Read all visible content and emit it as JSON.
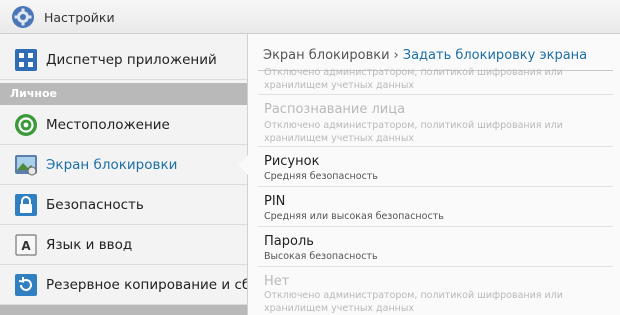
{
  "header": {
    "title": "Настройки",
    "icon": "settings-gear-icon"
  },
  "sidebar": {
    "items": [
      {
        "label": "Диспетчер приложений",
        "icon": "app-grid-icon"
      },
      {
        "section": "Личное"
      },
      {
        "label": "Местоположение",
        "icon": "location-icon"
      },
      {
        "label": "Экран блокировки",
        "icon": "lock-screen-icon",
        "active": true
      },
      {
        "label": "Безопасность",
        "icon": "padlock-icon"
      },
      {
        "label": "Язык и ввод",
        "icon": "keyboard-a-icon"
      },
      {
        "label": "Резервное копирование и сб...",
        "icon": "backup-icon"
      }
    ]
  },
  "breadcrumb": {
    "parent": "Экран блокировки",
    "separator": "›",
    "current": "Задать блокировку экрана"
  },
  "options": [
    {
      "title": "",
      "subtitle": "Отключено администратором, политикой шифрования или хранилищем учетных данных",
      "enabled": false
    },
    {
      "title": "Распознавание лица",
      "subtitle": "Отключено администратором, политикой шифрования или хранилищем учетных данных",
      "enabled": false
    },
    {
      "title": "Рисунок",
      "subtitle": "Средняя безопасность",
      "enabled": true
    },
    {
      "title": "PIN",
      "subtitle": "Средняя или высокая безопасность",
      "enabled": true
    },
    {
      "title": "Пароль",
      "subtitle": "Высокая безопасность",
      "enabled": true
    },
    {
      "title": "Нет",
      "subtitle": "Отключено администратором, политикой шифрования или хранилищем учетных данных",
      "enabled": false
    }
  ],
  "colors": {
    "accent": "#1d6fa5",
    "section": "#b9b9b9",
    "disabled": "#b9b9b9"
  }
}
